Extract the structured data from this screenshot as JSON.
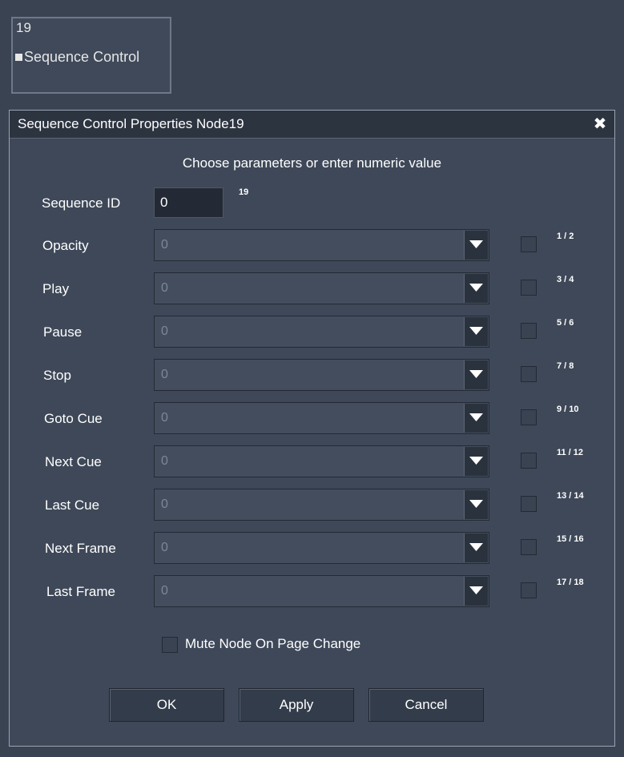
{
  "node": {
    "id": "19",
    "label": "Sequence Control"
  },
  "dialog": {
    "title": "Sequence Control Properties Node19",
    "close_glyph": "✖",
    "instruction": "Choose parameters or enter numeric value",
    "sequence_id": {
      "label": "Sequence ID",
      "value": "0",
      "note": "19"
    },
    "rows": [
      {
        "label": "Opacity",
        "value": "0",
        "note": "1 / 2"
      },
      {
        "label": "Play",
        "value": "0",
        "note": "3 / 4"
      },
      {
        "label": "Pause",
        "value": "0",
        "note": "5 / 6"
      },
      {
        "label": "Stop",
        "value": "0",
        "note": "7 / 8"
      },
      {
        "label": "Goto Cue",
        "value": "0",
        "note": "9 / 10"
      },
      {
        "label": "Next Cue",
        "value": "0",
        "note": "11 / 12"
      },
      {
        "label": "Last Cue",
        "value": "0",
        "note": "13 / 14"
      },
      {
        "label": "Next Frame",
        "value": "0",
        "note": "15 / 16"
      },
      {
        "label": "Last Frame",
        "value": "0",
        "note": "17 / 18"
      }
    ],
    "mute_label": "Mute Node On Page Change",
    "buttons": {
      "ok": "OK",
      "apply": "Apply",
      "cancel": "Cancel"
    }
  }
}
